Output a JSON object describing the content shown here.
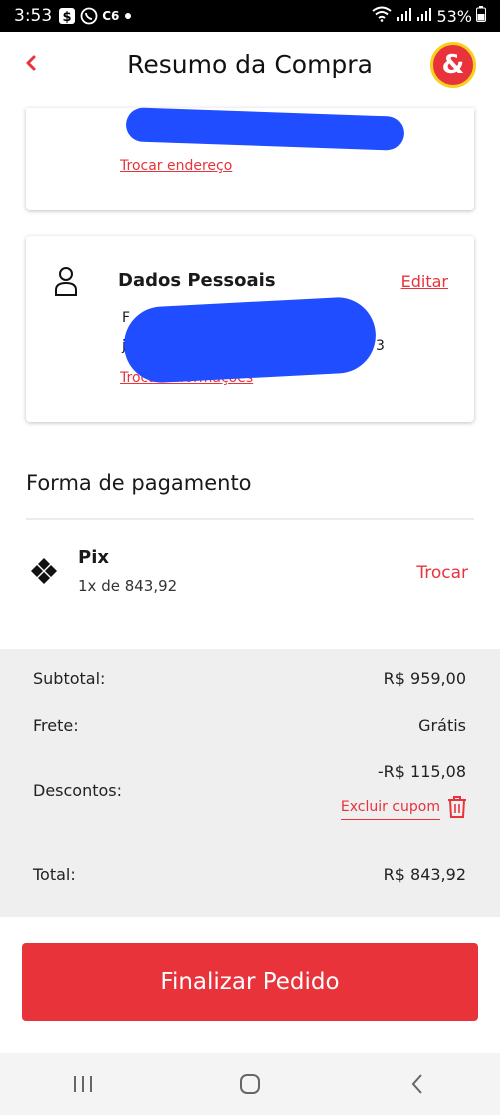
{
  "status_bar": {
    "time": "3:53",
    "icons": [
      "dollar-app-icon",
      "whatsapp-icon",
      "c6-icon",
      "dot-icon"
    ],
    "c6_label": "C6",
    "battery": "53%"
  },
  "header": {
    "back_icon": "chevron-left-icon",
    "title": "Resumo da Compra",
    "logo_text": "&"
  },
  "address_card": {
    "change_link": "Trocar endereço"
  },
  "personal_card": {
    "title": "Dados Pessoais",
    "edit_link": "Editar",
    "line1_start": "F",
    "line2_start": "jh",
    "line2_end": "3",
    "change_link": "Trocar informações"
  },
  "payment": {
    "section_title": "Forma de pagamento",
    "method_name": "Pix",
    "installments": "1x de 843,92",
    "change_label": "Trocar"
  },
  "summary": {
    "subtotal_label": "Subtotal:",
    "subtotal_value": "R$ 959,00",
    "shipping_label": "Frete:",
    "shipping_value": "Grátis",
    "discount_label": "Descontos:",
    "discount_value": "-R$ 115,08",
    "remove_coupon": "Excluir cupom",
    "total_label": "Total:",
    "total_value": "R$ 843,92"
  },
  "cta": {
    "label": "Finalizar Pedido"
  },
  "colors": {
    "accent": "#e8333b",
    "logo_ring": "#f7d11e",
    "redaction": "#1f4dff",
    "summary_bg": "#efefef"
  }
}
